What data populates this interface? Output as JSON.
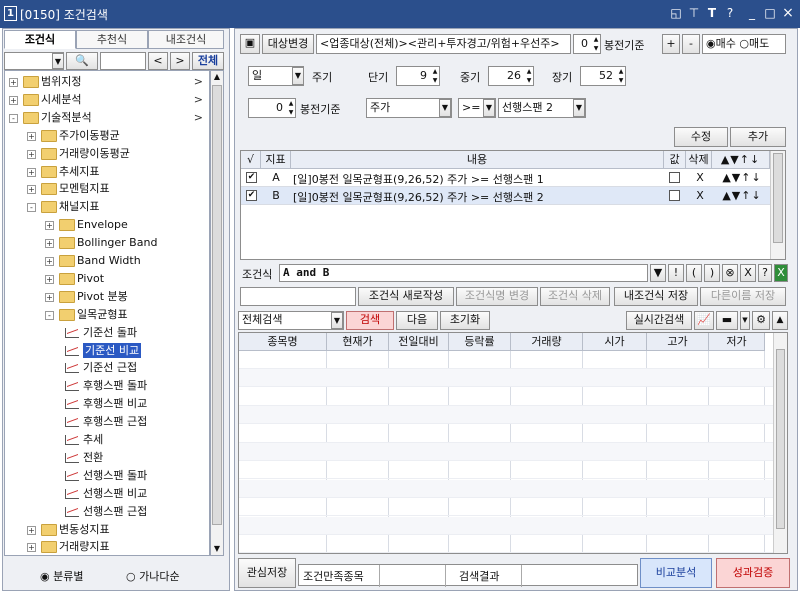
{
  "window": {
    "number": "1",
    "title": "[0150] 조건검색",
    "controls": [
      "◱",
      "⊤",
      "T",
      "?",
      "_",
      "□",
      "×"
    ]
  },
  "left": {
    "tabs": [
      "조건식",
      "추천식",
      "내조건식"
    ],
    "search_btn": "전체",
    "tree": [
      {
        "label": "범위지정",
        "level": 0,
        "exp": "+",
        "arrow": ">"
      },
      {
        "label": "시세분석",
        "level": 0,
        "exp": "+",
        "arrow": ">"
      },
      {
        "label": "기술적분석",
        "level": 0,
        "exp": "-",
        "arrow": ">"
      },
      {
        "label": "주가이동평균",
        "level": 1,
        "exp": "+"
      },
      {
        "label": "거래량이동평균",
        "level": 1,
        "exp": "+"
      },
      {
        "label": "추세지표",
        "level": 1,
        "exp": "+"
      },
      {
        "label": "모멘텀지표",
        "level": 1,
        "exp": "+"
      },
      {
        "label": "채널지표",
        "level": 1,
        "exp": "-"
      },
      {
        "label": "Envelope",
        "level": 2,
        "exp": "+"
      },
      {
        "label": "Bollinger Band",
        "level": 2,
        "exp": "+"
      },
      {
        "label": "Band Width",
        "level": 2,
        "exp": "+"
      },
      {
        "label": "Pivot",
        "level": 2,
        "exp": "+"
      },
      {
        "label": "Pivot 분봉",
        "level": 2,
        "exp": "+"
      },
      {
        "label": "일목균형표",
        "level": 2,
        "exp": "-"
      },
      {
        "label": "기준선 돌파",
        "level": 3,
        "leaf": true
      },
      {
        "label": "기준선 비교",
        "level": 3,
        "leaf": true,
        "selected": true
      },
      {
        "label": "기준선 근접",
        "level": 3,
        "leaf": true
      },
      {
        "label": "후행스팬 돌파",
        "level": 3,
        "leaf": true
      },
      {
        "label": "후행스팬 비교",
        "level": 3,
        "leaf": true
      },
      {
        "label": "후행스팬 근접",
        "level": 3,
        "leaf": true
      },
      {
        "label": "추세",
        "level": 3,
        "leaf": true
      },
      {
        "label": "전환",
        "level": 3,
        "leaf": true
      },
      {
        "label": "선행스팬 돌파",
        "level": 3,
        "leaf": true
      },
      {
        "label": "선행스팬 비교",
        "level": 3,
        "leaf": true
      },
      {
        "label": "선행스팬 근접",
        "level": 3,
        "leaf": true
      },
      {
        "label": "변동성지표",
        "level": 1,
        "exp": "+"
      },
      {
        "label": "거래량지표",
        "level": 1,
        "exp": "+"
      }
    ],
    "radio1": "분류별",
    "radio2": "가나다순"
  },
  "top": {
    "target_btn": "대상변경",
    "target_text": "<업종대상(전체)><관리+투자경고/위험+우선주>",
    "bong_val": "0",
    "bong_label": "봉전기준",
    "plus": "+",
    "minus": "-",
    "buy": "매수",
    "sell": "매도"
  },
  "params": {
    "period_select": "일",
    "period_label": "주기",
    "short_label": "단기",
    "short_val": "9",
    "mid_label": "중기",
    "mid_val": "26",
    "long_label": "장기",
    "long_val": "52",
    "bong_val": "0",
    "bong_label": "봉전기준",
    "sel1": "주가",
    "sel2": ">=",
    "sel3": "선행스팬 2",
    "modify": "수정",
    "add": "추가"
  },
  "cond_table": {
    "headers": [
      "√",
      "지표",
      "내용",
      "값",
      "삭제",
      "▲▼↑↓"
    ],
    "rows": [
      {
        "check": "✔",
        "id": "A",
        "content": "[일]0봉전 일목균형표(9,26,52) 주가 >= 선행스팬 1",
        "del": "X",
        "ctrl": "▲▼↑↓"
      },
      {
        "check": "✔",
        "id": "B",
        "content": "[일]0봉전 일목균형표(9,26,52) 주가 >= 선행스팬 2",
        "del": "X",
        "ctrl": "▲▼↑↓"
      }
    ]
  },
  "expr": {
    "label": "조건식",
    "value": "A and B",
    "ops": [
      "▼",
      "!",
      "(",
      ")",
      "⊗",
      "X",
      "?"
    ]
  },
  "actions": [
    "조건식 새로작성",
    "조건식명 변경",
    "조건식 삭제",
    "내조건식 저장",
    "다른이름 저장"
  ],
  "search": {
    "scope": "전체검색",
    "search": "검색",
    "next": "다음",
    "reset": "초기화",
    "realtime": "실시간검색"
  },
  "results": {
    "headers": [
      "종목명",
      "현재가",
      "전일대비",
      "등락률",
      "거래량",
      "시가",
      "고가",
      "저가"
    ]
  },
  "bottom": {
    "save": "관심저장",
    "count_label": "조건만족종목",
    "result_label": "검색결과",
    "compare": "비교분석",
    "verify": "성과검증"
  }
}
